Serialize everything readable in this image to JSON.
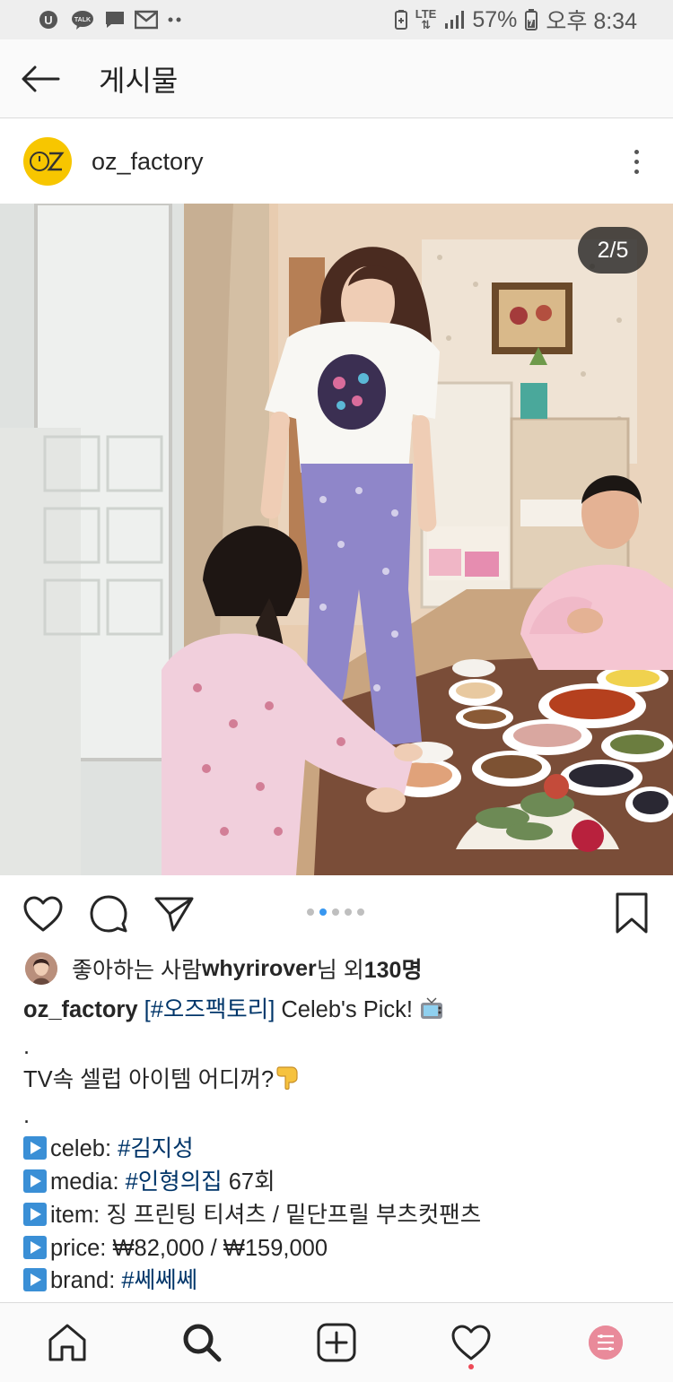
{
  "status_bar": {
    "battery": "57%",
    "time": "오후 8:34",
    "network": "LTE",
    "left_icons": [
      "u-plus-icon",
      "kakao-talk-icon",
      "message-icon",
      "gmail-icon",
      "more-notifications-icon"
    ]
  },
  "header": {
    "title": "게시물"
  },
  "post": {
    "username": "oz_factory",
    "avatar_text": "OZ",
    "image_counter": "2/5",
    "carousel_total": 5,
    "carousel_active": 2
  },
  "likes": {
    "prefix": "좋아하는 사람 ",
    "user": "whyrirover",
    "middle": "님 외 ",
    "count": "130명"
  },
  "caption": {
    "username": "oz_factory",
    "tag_main": "[#오즈팩토리]",
    "title_rest": " Celeb's Pick! ",
    "dot1": ".",
    "line2": "TV속 셀럽 아이템 어디꺼?",
    "dot2": ".",
    "celeb_label": "celeb: ",
    "celeb_tag": "#김지성",
    "media_label": "media: ",
    "media_tag": "#인형의집",
    "media_rest": " 67회",
    "item_label": "item: 징 프린팅 티셔츠 / 밑단프릴 부츠컷팬츠",
    "price_label": "price: ₩82,000 / ₩159,000",
    "brand_label": "brand: ",
    "brand_tag": "#쎄쎄쎄"
  },
  "colors": {
    "link": "#003569",
    "accent_blue": "#3897f0",
    "notif_red": "#ed4956",
    "oz_yellow": "#f7c600"
  }
}
